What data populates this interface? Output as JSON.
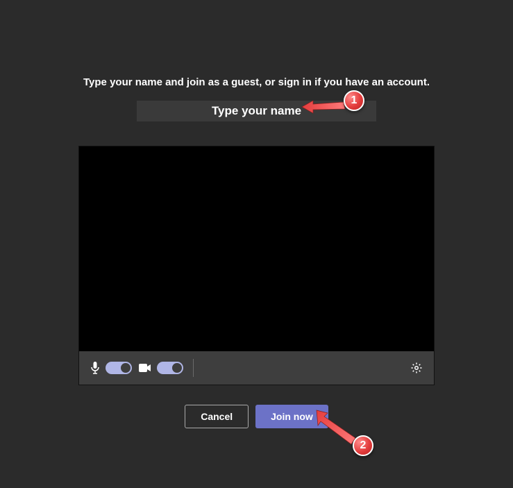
{
  "instruction": "Type your name and join as a guest, or sign in if you have an account.",
  "nameField": {
    "placeholder": "Type your name",
    "value": ""
  },
  "controls": {
    "micOn": true,
    "cameraOn": true
  },
  "buttons": {
    "cancel": "Cancel",
    "join": "Join now"
  },
  "annotations": {
    "step1": "1",
    "step2": "2"
  },
  "colors": {
    "accent": "#6c72c7",
    "toggleTrack": "#b0b6e6",
    "annotation": "#e43d3d"
  }
}
